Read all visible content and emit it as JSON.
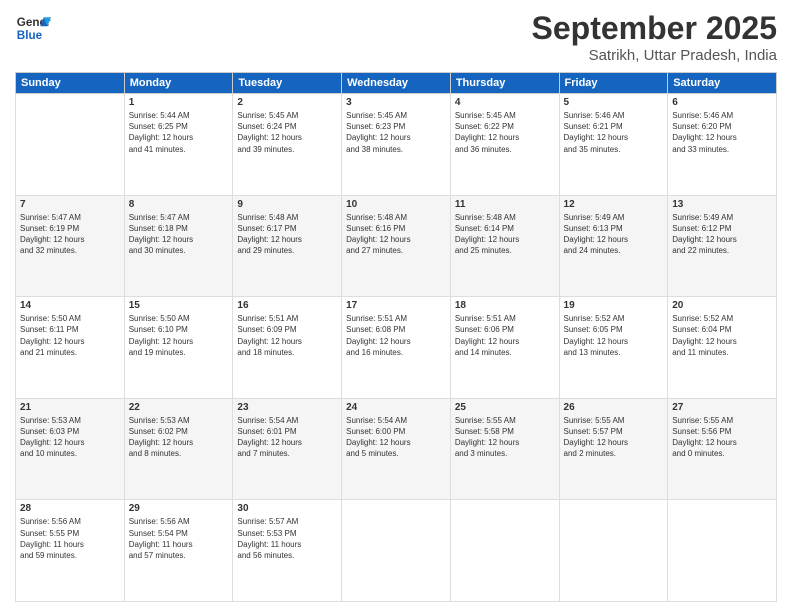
{
  "header": {
    "logo_line1": "General",
    "logo_line2": "Blue",
    "month": "September 2025",
    "location": "Satrikh, Uttar Pradesh, India"
  },
  "weekdays": [
    "Sunday",
    "Monday",
    "Tuesday",
    "Wednesday",
    "Thursday",
    "Friday",
    "Saturday"
  ],
  "weeks": [
    [
      {
        "day": "",
        "info": ""
      },
      {
        "day": "1",
        "info": "Sunrise: 5:44 AM\nSunset: 6:25 PM\nDaylight: 12 hours\nand 41 minutes."
      },
      {
        "day": "2",
        "info": "Sunrise: 5:45 AM\nSunset: 6:24 PM\nDaylight: 12 hours\nand 39 minutes."
      },
      {
        "day": "3",
        "info": "Sunrise: 5:45 AM\nSunset: 6:23 PM\nDaylight: 12 hours\nand 38 minutes."
      },
      {
        "day": "4",
        "info": "Sunrise: 5:45 AM\nSunset: 6:22 PM\nDaylight: 12 hours\nand 36 minutes."
      },
      {
        "day": "5",
        "info": "Sunrise: 5:46 AM\nSunset: 6:21 PM\nDaylight: 12 hours\nand 35 minutes."
      },
      {
        "day": "6",
        "info": "Sunrise: 5:46 AM\nSunset: 6:20 PM\nDaylight: 12 hours\nand 33 minutes."
      }
    ],
    [
      {
        "day": "7",
        "info": "Sunrise: 5:47 AM\nSunset: 6:19 PM\nDaylight: 12 hours\nand 32 minutes."
      },
      {
        "day": "8",
        "info": "Sunrise: 5:47 AM\nSunset: 6:18 PM\nDaylight: 12 hours\nand 30 minutes."
      },
      {
        "day": "9",
        "info": "Sunrise: 5:48 AM\nSunset: 6:17 PM\nDaylight: 12 hours\nand 29 minutes."
      },
      {
        "day": "10",
        "info": "Sunrise: 5:48 AM\nSunset: 6:16 PM\nDaylight: 12 hours\nand 27 minutes."
      },
      {
        "day": "11",
        "info": "Sunrise: 5:48 AM\nSunset: 6:14 PM\nDaylight: 12 hours\nand 25 minutes."
      },
      {
        "day": "12",
        "info": "Sunrise: 5:49 AM\nSunset: 6:13 PM\nDaylight: 12 hours\nand 24 minutes."
      },
      {
        "day": "13",
        "info": "Sunrise: 5:49 AM\nSunset: 6:12 PM\nDaylight: 12 hours\nand 22 minutes."
      }
    ],
    [
      {
        "day": "14",
        "info": "Sunrise: 5:50 AM\nSunset: 6:11 PM\nDaylight: 12 hours\nand 21 minutes."
      },
      {
        "day": "15",
        "info": "Sunrise: 5:50 AM\nSunset: 6:10 PM\nDaylight: 12 hours\nand 19 minutes."
      },
      {
        "day": "16",
        "info": "Sunrise: 5:51 AM\nSunset: 6:09 PM\nDaylight: 12 hours\nand 18 minutes."
      },
      {
        "day": "17",
        "info": "Sunrise: 5:51 AM\nSunset: 6:08 PM\nDaylight: 12 hours\nand 16 minutes."
      },
      {
        "day": "18",
        "info": "Sunrise: 5:51 AM\nSunset: 6:06 PM\nDaylight: 12 hours\nand 14 minutes."
      },
      {
        "day": "19",
        "info": "Sunrise: 5:52 AM\nSunset: 6:05 PM\nDaylight: 12 hours\nand 13 minutes."
      },
      {
        "day": "20",
        "info": "Sunrise: 5:52 AM\nSunset: 6:04 PM\nDaylight: 12 hours\nand 11 minutes."
      }
    ],
    [
      {
        "day": "21",
        "info": "Sunrise: 5:53 AM\nSunset: 6:03 PM\nDaylight: 12 hours\nand 10 minutes."
      },
      {
        "day": "22",
        "info": "Sunrise: 5:53 AM\nSunset: 6:02 PM\nDaylight: 12 hours\nand 8 minutes."
      },
      {
        "day": "23",
        "info": "Sunrise: 5:54 AM\nSunset: 6:01 PM\nDaylight: 12 hours\nand 7 minutes."
      },
      {
        "day": "24",
        "info": "Sunrise: 5:54 AM\nSunset: 6:00 PM\nDaylight: 12 hours\nand 5 minutes."
      },
      {
        "day": "25",
        "info": "Sunrise: 5:55 AM\nSunset: 5:58 PM\nDaylight: 12 hours\nand 3 minutes."
      },
      {
        "day": "26",
        "info": "Sunrise: 5:55 AM\nSunset: 5:57 PM\nDaylight: 12 hours\nand 2 minutes."
      },
      {
        "day": "27",
        "info": "Sunrise: 5:55 AM\nSunset: 5:56 PM\nDaylight: 12 hours\nand 0 minutes."
      }
    ],
    [
      {
        "day": "28",
        "info": "Sunrise: 5:56 AM\nSunset: 5:55 PM\nDaylight: 11 hours\nand 59 minutes."
      },
      {
        "day": "29",
        "info": "Sunrise: 5:56 AM\nSunset: 5:54 PM\nDaylight: 11 hours\nand 57 minutes."
      },
      {
        "day": "30",
        "info": "Sunrise: 5:57 AM\nSunset: 5:53 PM\nDaylight: 11 hours\nand 56 minutes."
      },
      {
        "day": "",
        "info": ""
      },
      {
        "day": "",
        "info": ""
      },
      {
        "day": "",
        "info": ""
      },
      {
        "day": "",
        "info": ""
      }
    ]
  ]
}
